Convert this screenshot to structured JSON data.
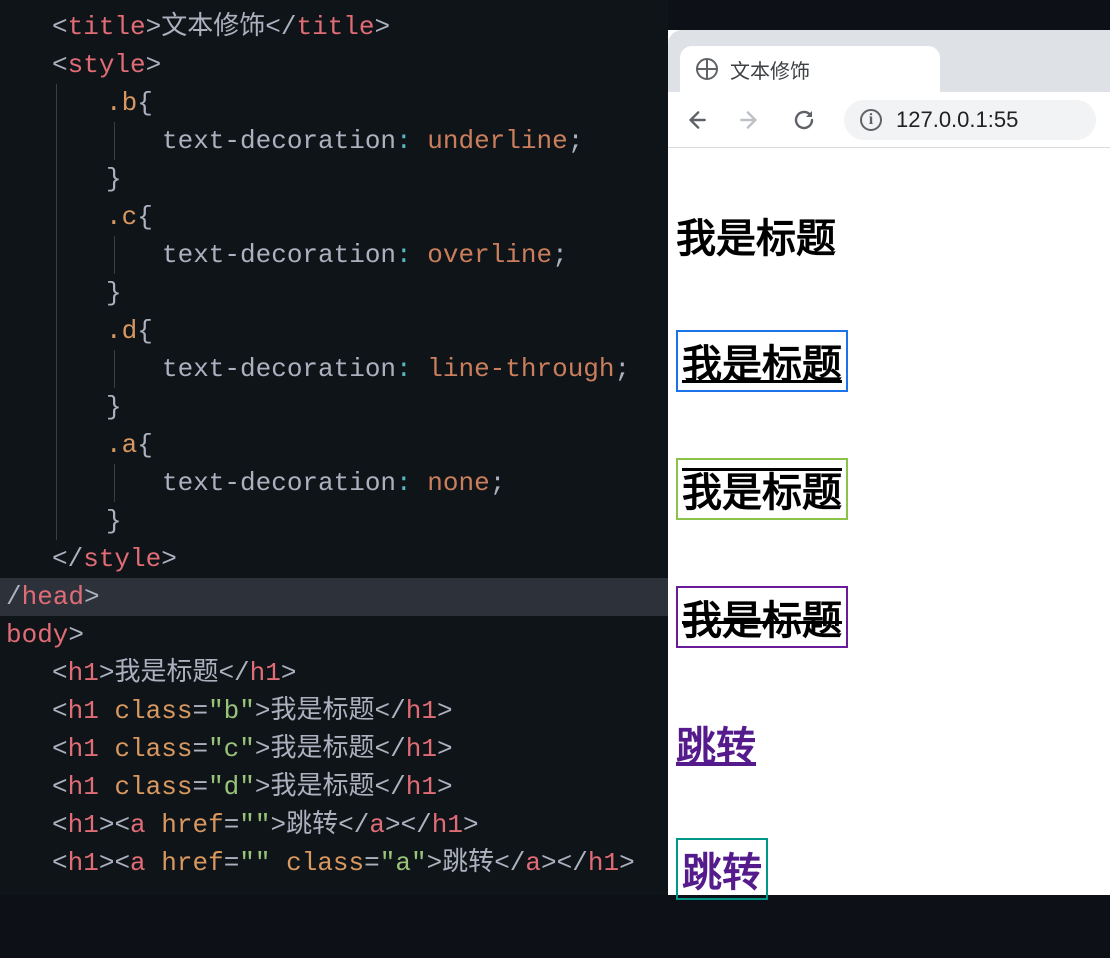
{
  "code": {
    "title_tag": "title",
    "title_text": "文本修饰",
    "style_tag": "style",
    "selectors": {
      "b": ".b",
      "c": ".c",
      "d": ".d",
      "a": ".a"
    },
    "prop": "text-decoration",
    "values": {
      "underline": "underline",
      "overline": "overline",
      "line_through": "line-through",
      "none": "none"
    },
    "head_tag": "head",
    "body_tag": "body",
    "h1_tag": "h1",
    "a_tag": "a",
    "class_attr": "class",
    "href_attr": "href",
    "class_b": "\"b\"",
    "class_c": "\"c\"",
    "class_d": "\"d\"",
    "class_a": "\"a\"",
    "href_empty": "\"\"",
    "heading_text": "我是标题",
    "link_text": "跳转",
    "brace_open": "{",
    "brace_close": "}",
    "semi": ";",
    "colon": ":",
    "lt": "<",
    "gt": ">",
    "lt_close": "</",
    "eq": "="
  },
  "browser": {
    "tab_title": "文本修饰",
    "url": "127.0.0.1:55"
  },
  "page": {
    "h1_plain": "我是标题",
    "h1_under": "我是标题",
    "h1_over": "我是标题",
    "h1_strike": "我是标题",
    "link1": "跳转",
    "link2": "跳转"
  },
  "icons": {
    "globe": "globe-icon",
    "back": "back-arrow-icon",
    "forward": "forward-arrow-icon",
    "reload": "reload-icon",
    "info": "info-icon"
  }
}
